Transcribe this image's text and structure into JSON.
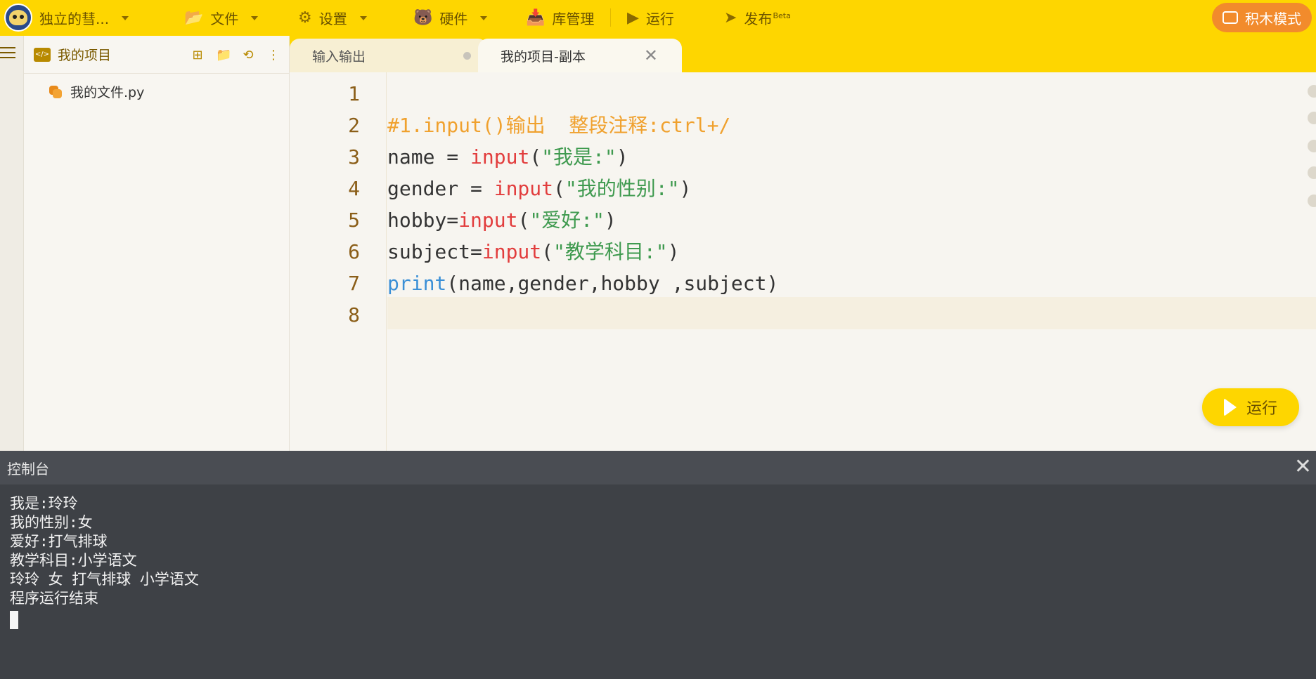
{
  "topbar": {
    "project_name": "独立的彗...",
    "menu": [
      {
        "label": "文件",
        "icon": "folder-icon"
      },
      {
        "label": "设置",
        "icon": "gear-icon"
      },
      {
        "label": "硬件",
        "icon": "hardware-icon"
      },
      {
        "label": "库管理",
        "icon": "library-icon"
      },
      {
        "label": "运行",
        "icon": "play-icon"
      },
      {
        "label": "发布",
        "badge": "Beta",
        "icon": "send-icon"
      }
    ],
    "block_mode": "积木模式",
    "accent": "#fed600"
  },
  "tabs": [
    {
      "label": "输入输出",
      "state": "unsaved"
    },
    {
      "label": "我的项目-副本",
      "state": "active"
    }
  ],
  "sidebar": {
    "title": "我的项目",
    "files": [
      "我的文件.py"
    ]
  },
  "editor": {
    "line_numbers": [
      "1",
      "2",
      "3",
      "4",
      "5",
      "6",
      "7",
      "8"
    ],
    "lines": [
      [],
      [
        {
          "t": "#1.input()输出  整段注释:ctrl+/",
          "c": "cmt"
        }
      ],
      [
        {
          "t": "name = ",
          "c": ""
        },
        {
          "t": "input",
          "c": "kw"
        },
        {
          "t": "(",
          "c": ""
        },
        {
          "t": "\"我是:\"",
          "c": "str"
        },
        {
          "t": ")",
          "c": ""
        }
      ],
      [
        {
          "t": "gender = ",
          "c": ""
        },
        {
          "t": "input",
          "c": "kw"
        },
        {
          "t": "(",
          "c": ""
        },
        {
          "t": "\"我的性别:\"",
          "c": "str"
        },
        {
          "t": ")",
          "c": ""
        }
      ],
      [
        {
          "t": "hobby=",
          "c": ""
        },
        {
          "t": "input",
          "c": "kw"
        },
        {
          "t": "(",
          "c": ""
        },
        {
          "t": "\"爱好:\"",
          "c": "str"
        },
        {
          "t": ")",
          "c": ""
        }
      ],
      [
        {
          "t": "subject=",
          "c": ""
        },
        {
          "t": "input",
          "c": "kw"
        },
        {
          "t": "(",
          "c": ""
        },
        {
          "t": "\"教学科目:\"",
          "c": "str"
        },
        {
          "t": ")",
          "c": ""
        }
      ],
      [
        {
          "t": "print",
          "c": "fn"
        },
        {
          "t": "(name,gender,hobby ,subject)",
          "c": ""
        }
      ],
      []
    ],
    "run_button": "运行"
  },
  "console": {
    "title": "控制台",
    "output": "我是:玲玲\n我的性别:女\n爱好:打气排球\n教学科目:小学语文\n玲玲 女 打气排球 小学语文\n程序运行结束"
  }
}
